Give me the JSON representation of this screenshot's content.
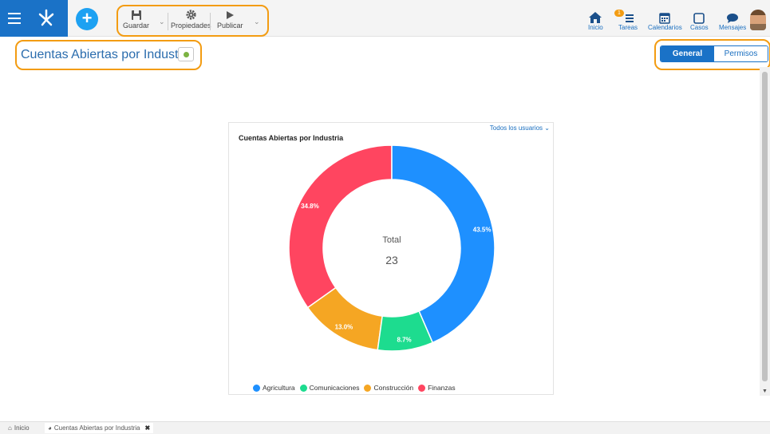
{
  "toolbar": {
    "save_label": "Guardar",
    "properties_label": "Propiedades",
    "publish_label": "Publicar"
  },
  "nav": {
    "home_label": "Inicio",
    "tasks_label": "Tareas",
    "tasks_badge": "1",
    "calendars_label": "Calendarios",
    "cases_label": "Casos",
    "messages_label": "Mensajes"
  },
  "page": {
    "title": "Cuentas Abiertas por Industria",
    "status_color": "#7cb342"
  },
  "tabs": [
    {
      "label": "General",
      "active": true
    },
    {
      "label": "Permisos",
      "active": false
    }
  ],
  "card": {
    "users_filter": "Todos los usuarios",
    "title": "Cuentas Abiertas por Industria",
    "center_label": "Total",
    "center_value": "23"
  },
  "chart_data": {
    "type": "pie",
    "donut": true,
    "title": "Cuentas Abiertas por Industria",
    "categories": [
      "Agricultura",
      "Comunicaciones",
      "Construcción",
      "Finanzas"
    ],
    "values": [
      43.5,
      8.7,
      13.0,
      34.8
    ],
    "labels": [
      "43.5%",
      "8.7%",
      "13.0%",
      "34.8%"
    ],
    "colors": [
      "#1e90ff",
      "#1ddc8f",
      "#f5a623",
      "#ff4560"
    ],
    "legend": "bottom"
  },
  "bottom_tabs": [
    {
      "label": "Inicio",
      "icon": "home-icon"
    },
    {
      "label": "Cuentas Abiertas por Industria",
      "icon": "pie-chart-icon",
      "close": "✖"
    }
  ]
}
